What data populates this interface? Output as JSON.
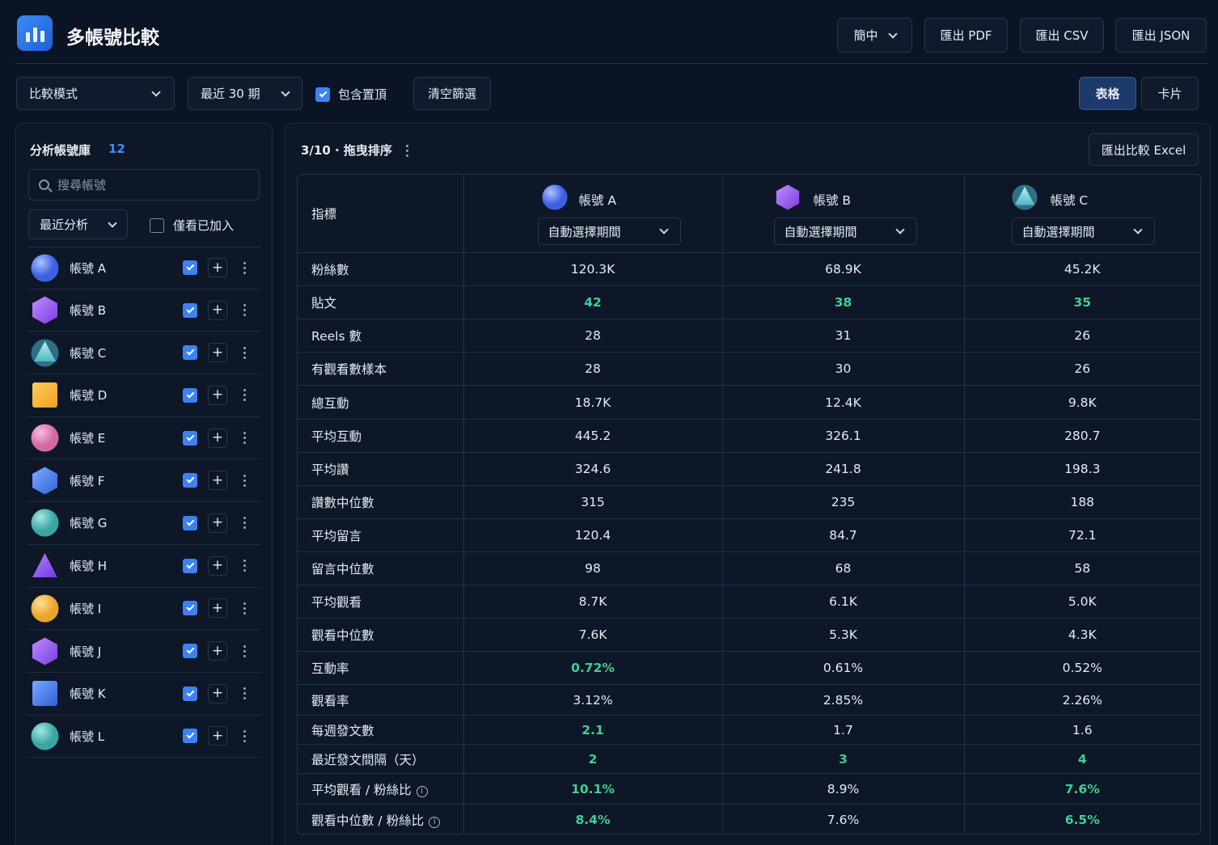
{
  "header": {
    "title": "多帳號比較",
    "lang": "簡中",
    "export_pdf": "匯出 PDF",
    "export_csv": "匯出 CSV",
    "export_json": "匯出 JSON"
  },
  "toolbar": {
    "mode": "比較模式",
    "period": "最近 30 期",
    "include_pinned": "包含置頂",
    "clear_filters": "清空篩選",
    "view_table": "表格",
    "view_card": "卡片"
  },
  "sidebar": {
    "title": "分析帳號庫",
    "count": "12",
    "search_placeholder": "搜尋帳號",
    "sort": "最近分析",
    "only_added": "僅看已加入",
    "accounts": [
      {
        "name": "帳號 A"
      },
      {
        "name": "帳號 B"
      },
      {
        "name": "帳號 C"
      },
      {
        "name": "帳號 D"
      },
      {
        "name": "帳號 E"
      },
      {
        "name": "帳號 F"
      },
      {
        "name": "帳號 G"
      },
      {
        "name": "帳號 H"
      },
      {
        "name": "帳號 I"
      },
      {
        "name": "帳號 J"
      },
      {
        "name": "帳號 K"
      },
      {
        "name": "帳號 L"
      }
    ]
  },
  "main": {
    "title": "3/10 · 拖曳排序",
    "export_excel": "匯出比較 Excel",
    "metric_header": "指標",
    "columns": [
      {
        "name": "帳號 A",
        "period": "自動選擇期間"
      },
      {
        "name": "帳號 B",
        "period": "自動選擇期間"
      },
      {
        "name": "帳號 C",
        "period": "自動選擇期間"
      }
    ],
    "rows": [
      {
        "label": "粉絲數",
        "values": [
          "120.3K",
          "68.9K",
          "45.2K"
        ]
      },
      {
        "label": "貼文",
        "values": [
          "42",
          "38",
          "35"
        ]
      },
      {
        "label": "Reels 數",
        "values": [
          "28",
          "31",
          "26"
        ]
      },
      {
        "label": "有觀看數樣本",
        "values": [
          "28",
          "30",
          "26"
        ]
      },
      {
        "label": "總互動",
        "values": [
          "18.7K",
          "12.4K",
          "9.8K"
        ]
      },
      {
        "label": "平均互動",
        "values": [
          "445.2",
          "326.1",
          "280.7"
        ]
      },
      {
        "label": "平均讚",
        "values": [
          "324.6",
          "241.8",
          "198.3"
        ]
      },
      {
        "label": "讚數中位數",
        "values": [
          "315",
          "235",
          "188"
        ]
      },
      {
        "label": "平均留言",
        "values": [
          "120.4",
          "84.7",
          "72.1"
        ]
      },
      {
        "label": "留言中位數",
        "values": [
          "98",
          "68",
          "58"
        ]
      },
      {
        "label": "平均觀看",
        "values": [
          "8.7K",
          "6.1K",
          "5.0K"
        ]
      },
      {
        "label": "觀看中位數",
        "values": [
          "7.6K",
          "5.3K",
          "4.3K"
        ]
      },
      {
        "label": "互動率",
        "values": [
          "0.72%",
          "0.61%",
          "0.52%"
        ]
      },
      {
        "label": "觀看率",
        "values": [
          "3.12%",
          "2.85%",
          "2.26%"
        ]
      },
      {
        "label": "每週發文數",
        "values": [
          "2.1",
          "1.7",
          "1.6"
        ]
      },
      {
        "label": "最近發文間隔（天）",
        "values": [
          "2",
          "3",
          "4"
        ]
      },
      {
        "label": "平均觀看 / 粉絲比",
        "values": [
          "10.1%",
          "8.9%",
          "7.6%"
        ]
      },
      {
        "label": "觀看中位數 / 粉絲比",
        "values": [
          "8.4%",
          "7.6%",
          "6.5%"
        ]
      }
    ]
  },
  "colors": {
    "background": "#0b1424",
    "accent": "#3b82f6",
    "highlight": "#3fcf93"
  }
}
